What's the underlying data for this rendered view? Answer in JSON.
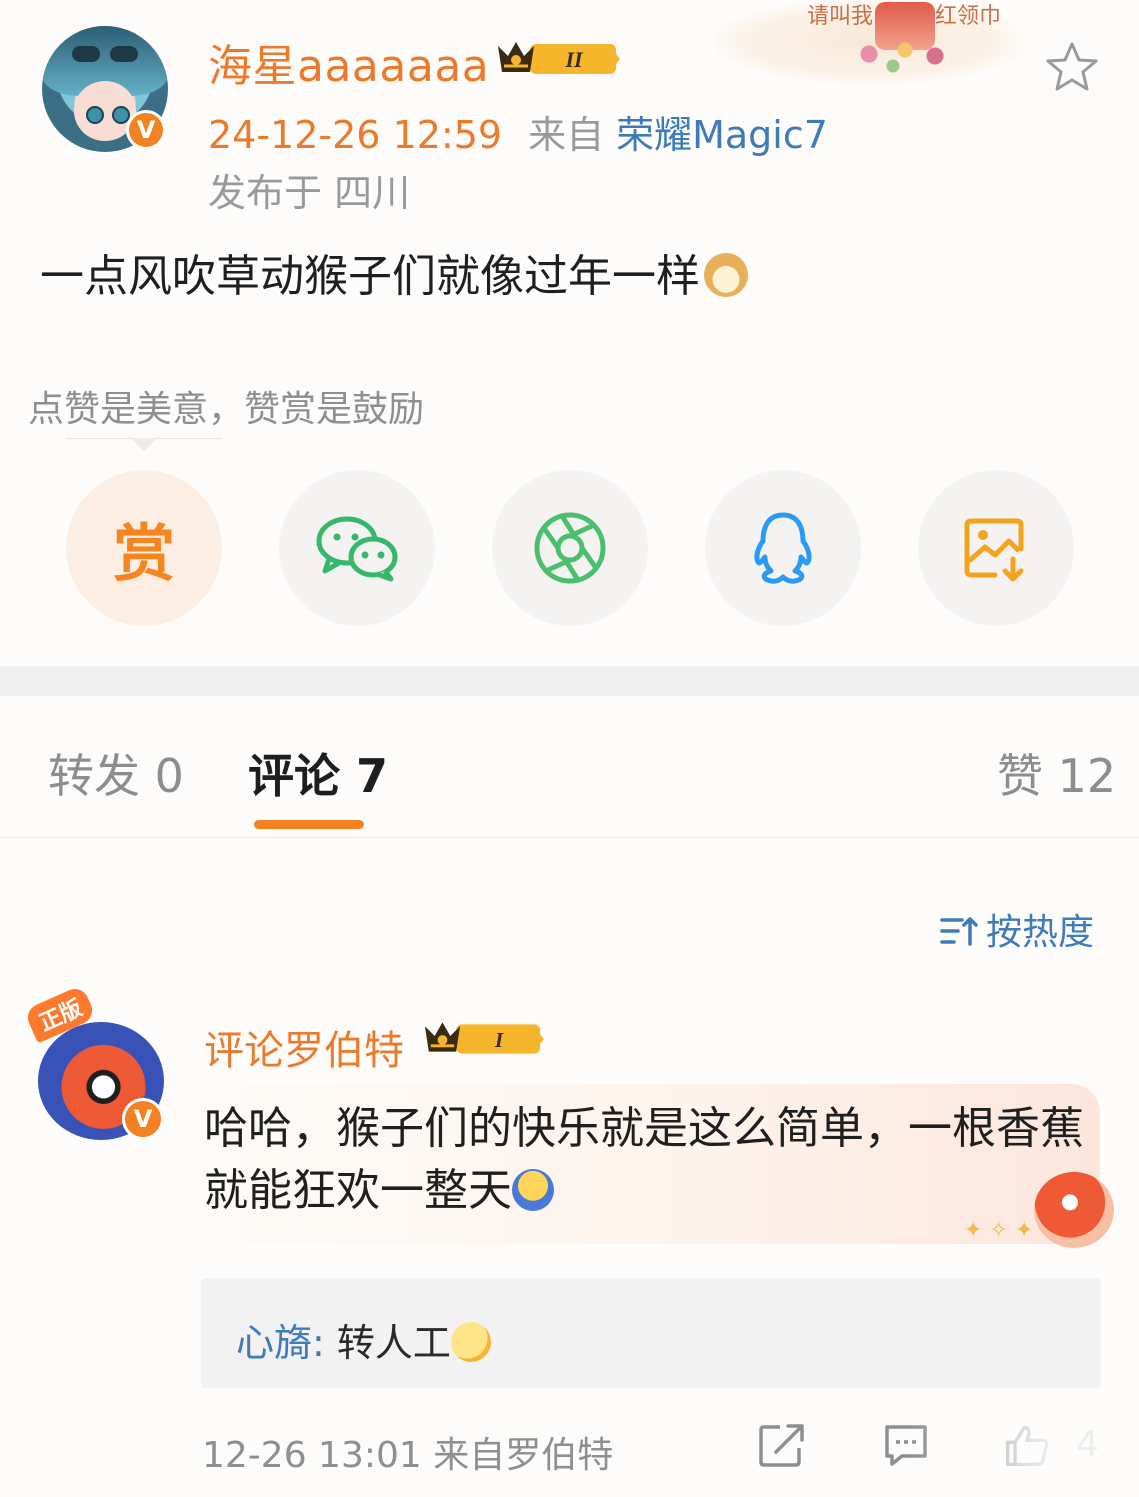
{
  "post": {
    "username": "海星aaaaaaa",
    "badge_level": "II",
    "verified_mark": "V",
    "time": "24-12-26 12:59",
    "from_prefix": "来自",
    "device": "荣耀Magic7",
    "location": "发布于 四川",
    "text": "一点风吹草动猴子们就像过年一样",
    "text_emoji": "doge-emoji",
    "banner_text_left": "请叫我",
    "banner_text_right": "红领巾"
  },
  "reward_tip": "点赞是美意，赞赏是鼓励",
  "share_actions": [
    {
      "label": "赏",
      "icon": "reward-icon"
    },
    {
      "label": "",
      "icon": "wechat-icon"
    },
    {
      "label": "",
      "icon": "moments-icon"
    },
    {
      "label": "",
      "icon": "qq-icon"
    },
    {
      "label": "",
      "icon": "save-image-icon"
    }
  ],
  "tabs": {
    "repost": "转发 0",
    "comments": "评论 7",
    "likes": "赞 12"
  },
  "sort_label": "按热度",
  "comment": {
    "tag": "正版",
    "username": "评论罗伯特",
    "badge_level": "I",
    "verified_mark": "V",
    "text": "哈哈，猴子们的快乐就是这么简单，一根香蕉就能狂欢一整天",
    "reply": {
      "user": "心旖",
      "separator": ": ",
      "text": "转人工"
    },
    "meta": "12-26 13:01  来自罗伯特",
    "like_count": "4"
  },
  "colors": {
    "accent_orange": "#f58220",
    "username_orange": "#eb7a2c",
    "link_blue": "#3e7bb8",
    "muted_gray": "#8f8f8f"
  }
}
